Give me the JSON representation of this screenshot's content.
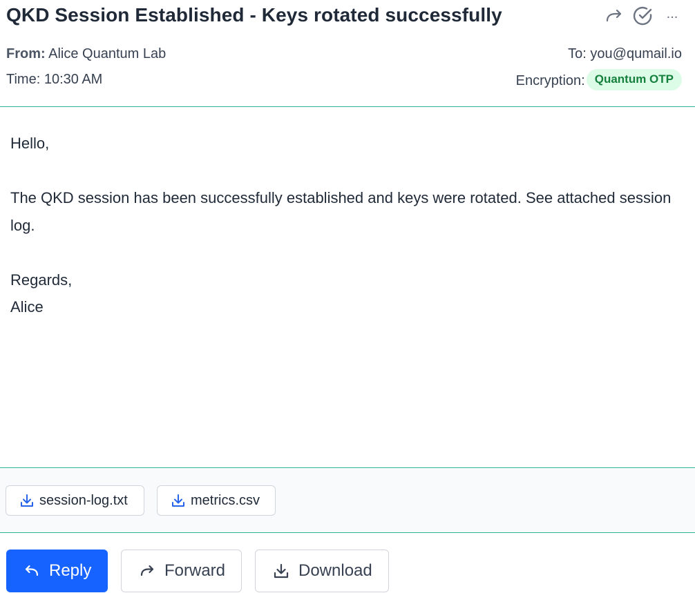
{
  "email": {
    "subject": "QKD Session Established - Keys rotated successfully",
    "from_label": "From:",
    "from_value": "Alice Quantum Lab",
    "time_label": "Time:",
    "time_value": "10:30 AM",
    "to_label": "To:",
    "to_value": "you@qumail.io",
    "encryption_label": "Encryption:",
    "encryption_badge": "Quantum OTP",
    "body": {
      "greeting": "Hello,",
      "paragraph": "The QKD session has been successfully established and keys were rotated. See attached session log.",
      "closing": "Regards,",
      "signature": "Alice"
    }
  },
  "header_actions": {
    "forward_icon": "forward-arrow-icon",
    "mark_done_icon": "check-circle-icon",
    "more": "..."
  },
  "attachments": [
    {
      "name": "session-log.txt",
      "icon": "download-icon"
    },
    {
      "name": "metrics.csv",
      "icon": "download-icon"
    }
  ],
  "actions": {
    "reply": "Reply",
    "forward": "Forward",
    "download": "Download"
  },
  "colors": {
    "accent": "#1763ff",
    "divider": "#2bb39a",
    "badge_bg": "#dcfce7",
    "badge_text": "#15803d"
  }
}
